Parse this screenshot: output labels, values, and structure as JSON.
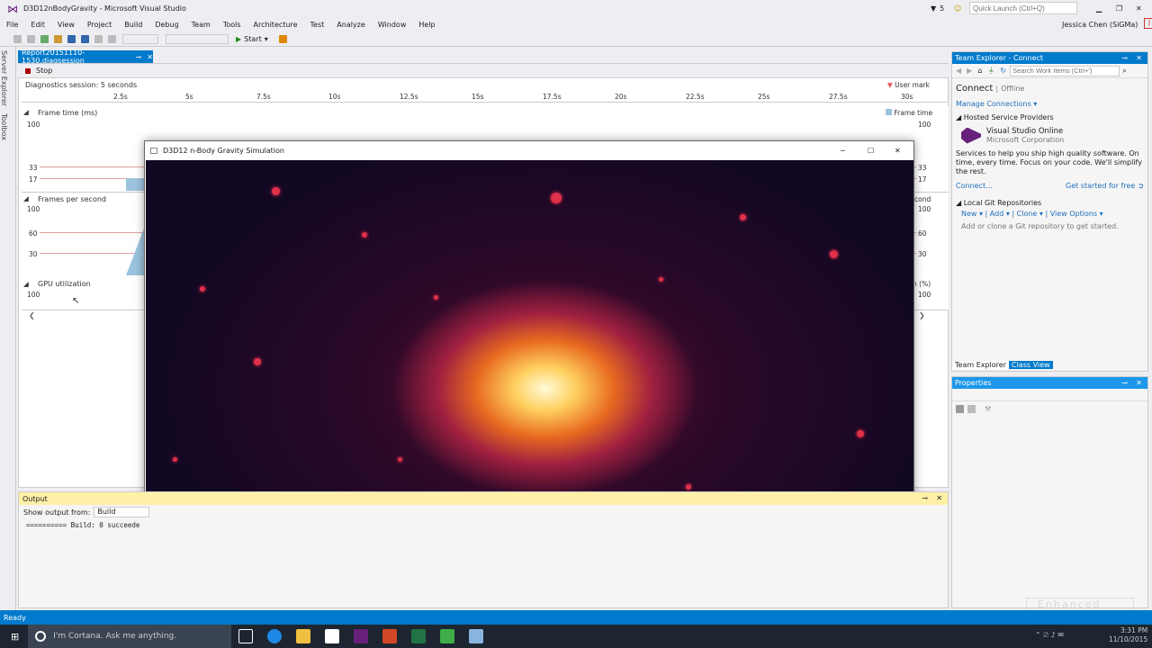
{
  "window": {
    "title": "D3D12nBodyGravity - Microsoft Visual Studio",
    "notif_count": "5",
    "quick_launch_placeholder": "Quick Launch (Ctrl+Q)",
    "user": "Jessica Chen (SiGMa)"
  },
  "menu": [
    "File",
    "Edit",
    "View",
    "Project",
    "Build",
    "Debug",
    "Team",
    "Tools",
    "Architecture",
    "Test",
    "Analyze",
    "Window",
    "Help"
  ],
  "toolbar": {
    "start_label": "Start"
  },
  "sidestrip": {
    "server_explorer": "Server Explorer",
    "toolbox": "Toolbox"
  },
  "doc": {
    "tab": "Report20151110-1530.diagsession",
    "stop": "Stop",
    "session": "Diagnostics session: 5 seconds",
    "user_mark": "User mark",
    "timeline": [
      "2.5s",
      "5s",
      "7.5s",
      "10s",
      "12.5s",
      "15s",
      "17.5s",
      "20s",
      "22.5s",
      "25s",
      "27.5s",
      "30s"
    ],
    "frame_time": {
      "label": "Frame time (ms)",
      "legend": "Frame time",
      "ticks": [
        "100",
        "33",
        "17"
      ]
    },
    "fps": {
      "label": "Frames per second",
      "legend": "cond",
      "ticks": [
        "100",
        "60",
        "30"
      ]
    },
    "gpu": {
      "label": "GPU utilization",
      "legend": "n (%)",
      "ticks": [
        "100"
      ]
    }
  },
  "sim": {
    "title": "D3D12 n-Body Gravity Simulation"
  },
  "team": {
    "title": "Team Explorer - Connect",
    "search": "Search Work Items (Ctrl+')",
    "connect": "Connect",
    "offline": "Offline",
    "manage": "Manage Connections",
    "hosted": "Hosted Service Providers",
    "vso": "Visual Studio Online",
    "corp": "Microsoft Corporation",
    "desc": "Services to help you ship high quality software. On time, every time. Focus on your code. We'll simplify the rest.",
    "connect_link": "Connect...",
    "started": "Get started for free",
    "git": "Local Git Repositories",
    "new": "New",
    "add": "Add",
    "clone": "Clone",
    "view_opts": "View Options",
    "git_hint": "Add or clone a Git repository to get started.",
    "tab1": "Team Explorer",
    "tab2": "Class View"
  },
  "props": {
    "title": "Properties"
  },
  "output": {
    "title": "Output",
    "show_from": "Show output from:",
    "source": "Build",
    "line": "========== Build: 0 succeede"
  },
  "status": "Ready",
  "taskbar": {
    "cortana": "I'm Cortana. Ask me anything.",
    "time": "3:31 PM",
    "date": "11/10/2015"
  },
  "watermark": {
    "line1": "Enhanced",
    "line2": "ducation"
  }
}
